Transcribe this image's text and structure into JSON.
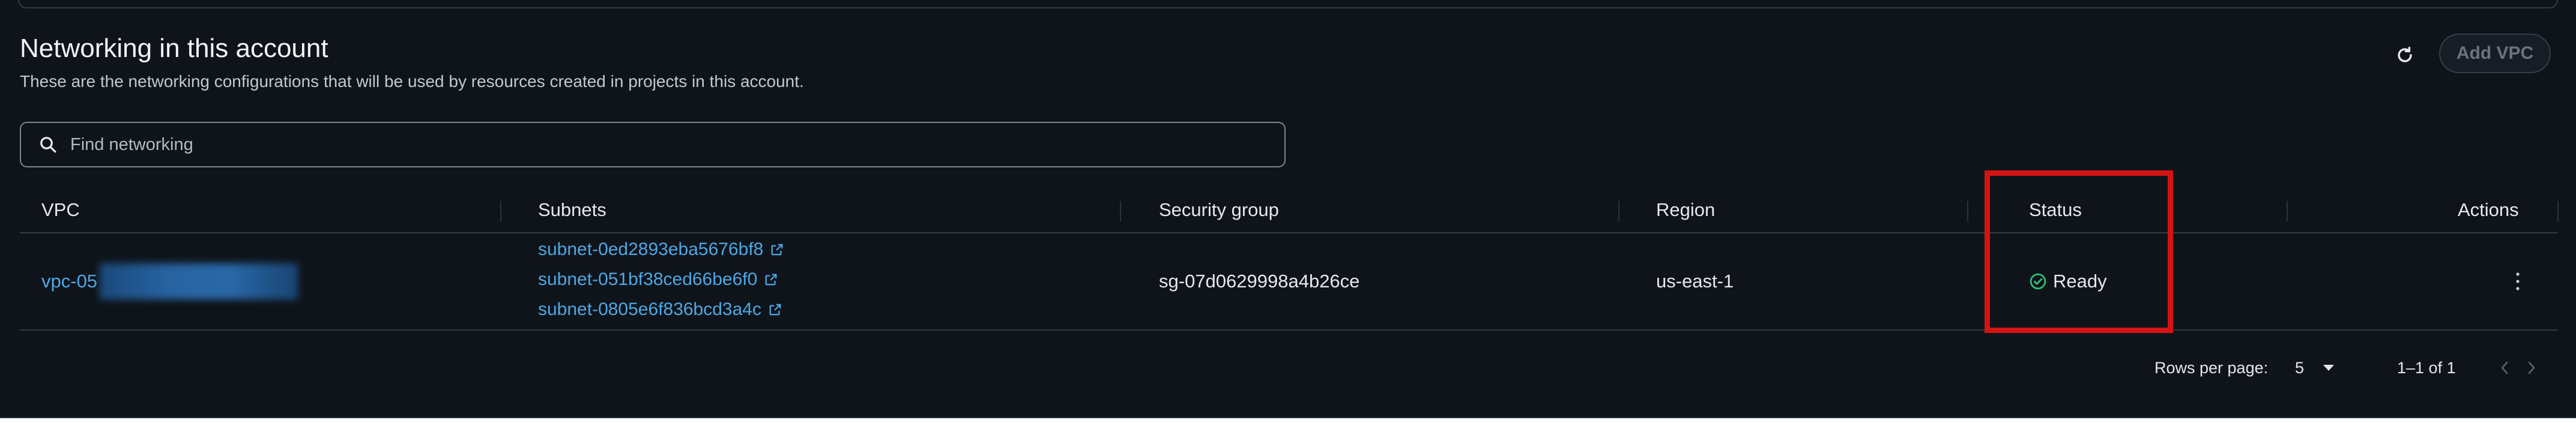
{
  "section": {
    "title": "Networking in this account",
    "subtitle": "These are the networking configurations that will be used by resources created in projects in this account."
  },
  "toolbar": {
    "refresh_icon": "refresh-icon",
    "add_vpc_label": "Add VPC"
  },
  "search": {
    "placeholder": "Find networking",
    "value": ""
  },
  "table": {
    "columns": [
      "VPC",
      "Subnets",
      "Security group",
      "Region",
      "Status",
      "Actions"
    ],
    "rows": [
      {
        "vpc": "vpc-05",
        "subnets": [
          "subnet-0ed2893eba5676bf8",
          "subnet-051bf38ced66be6f0",
          "subnet-0805e6f836bcd3a4c"
        ],
        "security_group": "sg-07d0629998a4b26ce",
        "region": "us-east-1",
        "status": "Ready"
      }
    ]
  },
  "pagination": {
    "rows_per_page_label": "Rows per page:",
    "rows_per_page_value": "5",
    "range_text": "1–1 of 1"
  },
  "colors": {
    "background": "#0f141b",
    "link": "#4ea8e3",
    "status_ready": "#2fbf71",
    "highlight": "#d41414"
  }
}
